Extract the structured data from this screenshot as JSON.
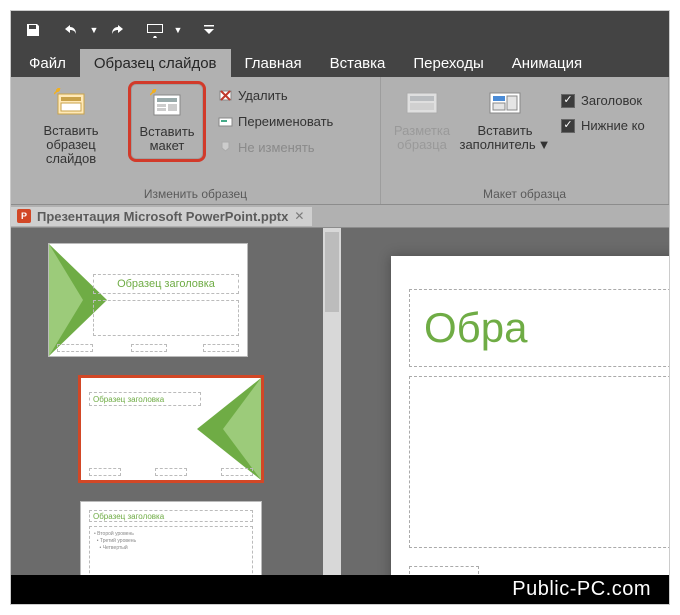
{
  "qat": {
    "save_icon": "save-icon",
    "undo_icon": "undo-icon",
    "redo_icon": "redo-icon",
    "slideshow_icon": "slideshow-icon",
    "customize_icon": "customize-icon"
  },
  "tabs": {
    "file": "Файл",
    "slide_master": "Образец слайдов",
    "home": "Главная",
    "insert": "Вставка",
    "transitions": "Переходы",
    "animations": "Анимация"
  },
  "ribbon": {
    "group1": {
      "insert_master": {
        "line1": "Вставить",
        "line2": "образец слайдов"
      },
      "insert_layout": {
        "line1": "Вставить",
        "line2": "макет"
      },
      "delete": "Удалить",
      "rename": "Переименовать",
      "preserve": "Не изменять",
      "label": "Изменить образец"
    },
    "group2": {
      "master_layout": {
        "line1": "Разметка",
        "line2": "образца"
      },
      "insert_placeholder": {
        "line1": "Вставить",
        "line2": "заполнитель"
      },
      "title_checkbox": "Заголовок",
      "footers_checkbox": "Нижние ко",
      "label": "Макет образца"
    }
  },
  "filetab": {
    "name": "Презентация Microsoft PowerPoint.pptx"
  },
  "thumbs": {
    "master_title": "Образец заголовка",
    "layout1_title": "Образец заголовка",
    "layout2_title": "Образец заголовка"
  },
  "slide": {
    "title_placeholder": "Обра"
  },
  "colors": {
    "accent_green": "#6FAC45",
    "highlight_red": "#D24726"
  },
  "watermark": "Public-PC.com"
}
